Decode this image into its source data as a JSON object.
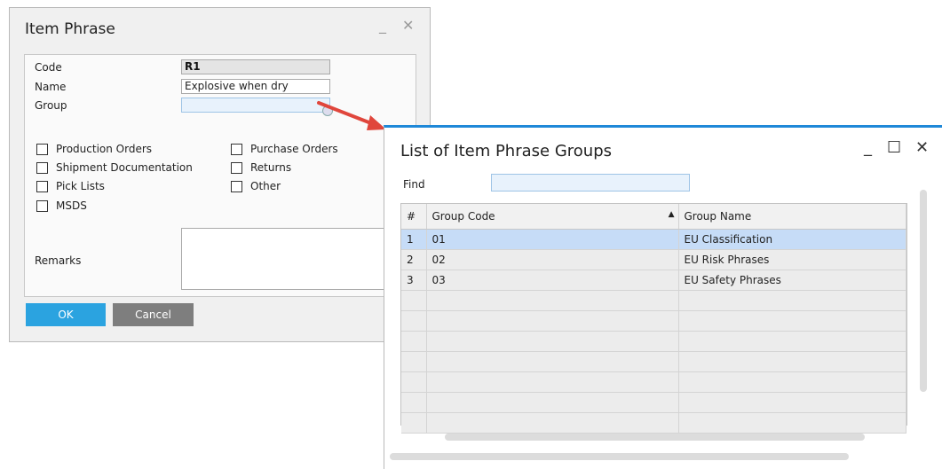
{
  "item_phrase": {
    "title": "Item Phrase",
    "code_label": "Code",
    "code_value": "R1",
    "name_label": "Name",
    "name_value": "Explosive when dry",
    "group_label": "Group",
    "group_value": "",
    "checkboxes_left": [
      "Production Orders",
      "Shipment Documentation",
      "Pick Lists",
      "MSDS"
    ],
    "checkboxes_right": [
      "Purchase Orders",
      "Returns",
      "Other"
    ],
    "remarks_label": "Remarks",
    "ok_label": "OK",
    "cancel_label": "Cancel",
    "minimize_glyph": "_",
    "close_glyph": "✕"
  },
  "group_list": {
    "title": "List of Item Phrase Groups",
    "find_label": "Find",
    "find_value": "",
    "columns": [
      "#",
      "Group Code",
      "Group Name"
    ],
    "rows": [
      {
        "num": "1",
        "code": "01",
        "name": "EU Classification"
      },
      {
        "num": "2",
        "code": "02",
        "name": "EU Risk Phrases"
      },
      {
        "num": "3",
        "code": "03",
        "name": "EU Safety Phrases"
      }
    ],
    "minimize_glyph": "_",
    "maximize_glyph": "☐",
    "close_glyph": "✕"
  },
  "colors": {
    "accent": "#1e88d8",
    "ok_button": "#2ba3e0",
    "cancel_button": "#7e7e7e",
    "selected_row": "#c6dcf7",
    "arrow": "#e0463c"
  }
}
